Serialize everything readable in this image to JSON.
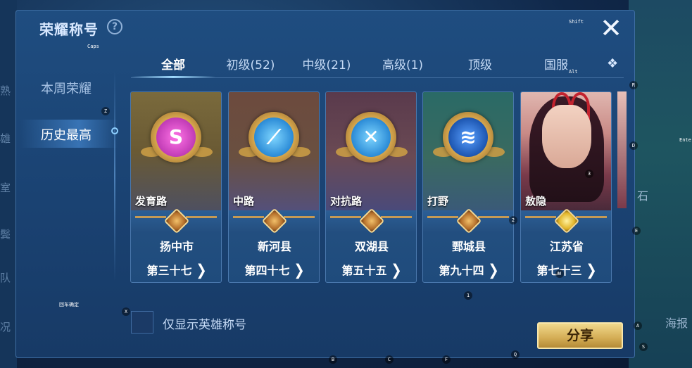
{
  "dialog": {
    "title": "荣耀称号",
    "help_glyph": "?",
    "close_glyph": "✕",
    "share_label": "分享",
    "checkbox_label": "仅显示英雄称号"
  },
  "sidebar": {
    "items": [
      {
        "label": "本周荣耀",
        "active": false
      },
      {
        "label": "历史最高",
        "active": true
      }
    ]
  },
  "tabs": [
    {
      "label": "全部",
      "active": true
    },
    {
      "label": "初级(52)",
      "active": false
    },
    {
      "label": "中级(21)",
      "active": false
    },
    {
      "label": "高级(1)",
      "active": false
    },
    {
      "label": "顶级",
      "active": false
    },
    {
      "label": "国服",
      "active": false
    }
  ],
  "tab_more_glyph": "❖",
  "cards": [
    {
      "label": "发育路",
      "region": "扬中市",
      "rank": "第三十七",
      "emblem": "marksman-emblem-icon",
      "emblem_glyph": "S"
    },
    {
      "label": "中路",
      "region": "新河县",
      "rank": "第四十七",
      "emblem": "mid-lane-emblem-icon",
      "emblem_glyph": "⟋"
    },
    {
      "label": "对抗路",
      "region": "双湖县",
      "rank": "第五十五",
      "emblem": "clash-lane-emblem-icon",
      "emblem_glyph": "✕"
    },
    {
      "label": "打野",
      "region": "鄄城县",
      "rank": "第九十四",
      "emblem": "jungle-emblem-icon",
      "emblem_glyph": "≋"
    },
    {
      "label": "敖隐",
      "region": "江苏省",
      "rank": "第七十三",
      "emblem": "hero-portrait",
      "emblem_glyph": ""
    }
  ],
  "chevron_glyph": "❯",
  "background": {
    "left_chars": [
      "熟",
      "雄",
      "室",
      "鬓",
      "队",
      "况"
    ],
    "right_stone": "石",
    "right_label": "海报"
  },
  "key_hints": [
    "Shift",
    "Caps",
    "Z",
    "Alt",
    "R",
    "D",
    "Enter",
    "E",
    "X",
    "1",
    "A",
    "S",
    "B",
    "C",
    "F",
    "Q",
    "2",
    "3",
    "W",
    "回车确定"
  ]
}
